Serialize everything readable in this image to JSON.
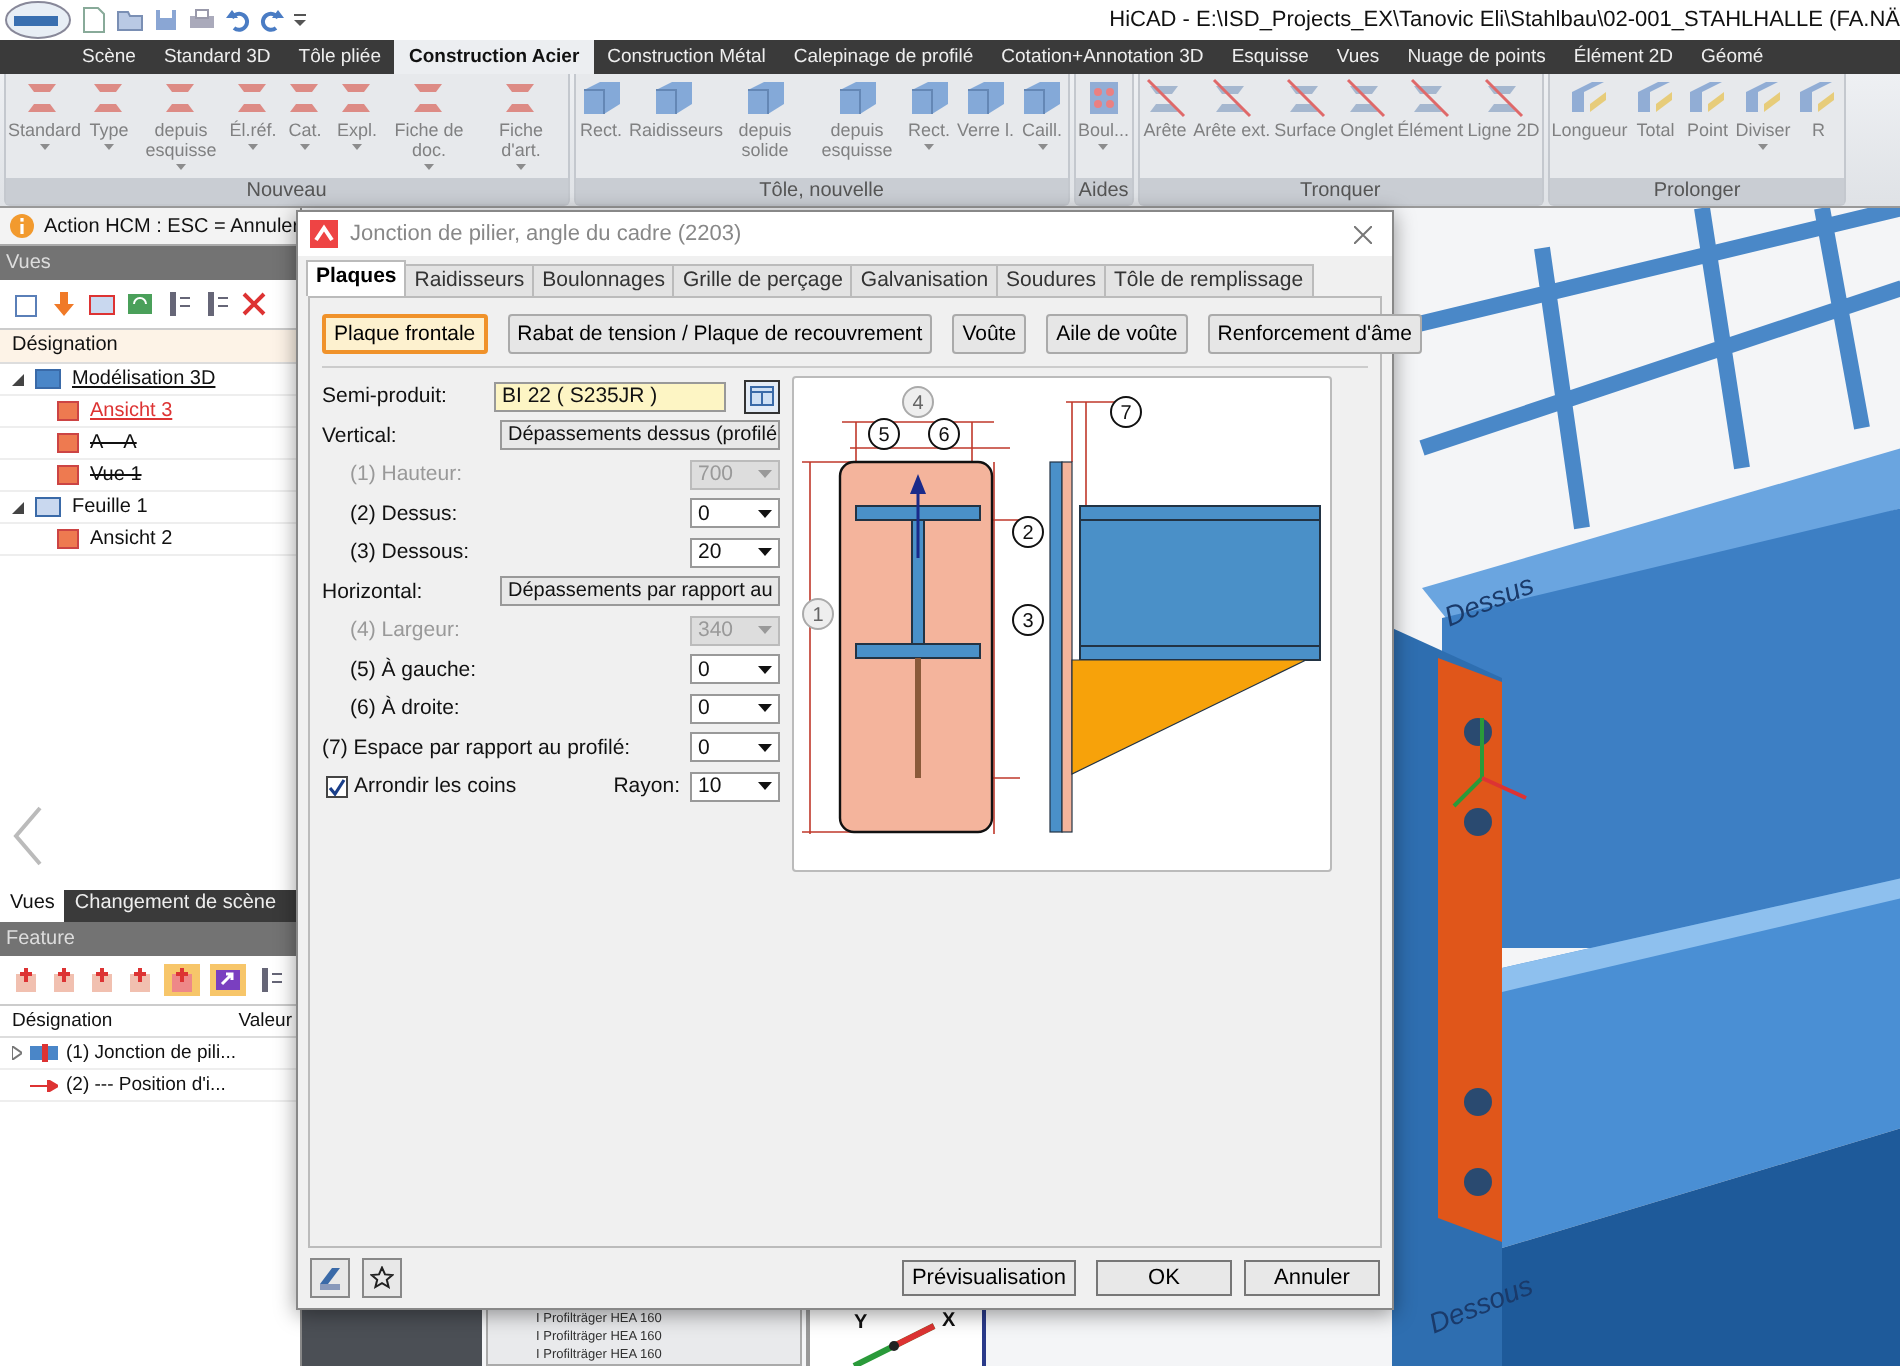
{
  "title_bar": {
    "title": "HiCAD - E:\\ISD_Projects_EX\\Tanovic Eli\\Stahlbau\\02-001_STAHLHALLE (FA.NÄ"
  },
  "ribbon_tabs": [
    {
      "label": "Scène",
      "selected": false
    },
    {
      "label": "Standard 3D",
      "selected": false
    },
    {
      "label": "Tôle pliée",
      "selected": false
    },
    {
      "label": "Construction Acier",
      "selected": true
    },
    {
      "label": "Construction Métal",
      "selected": false
    },
    {
      "label": "Calepinage de profilé",
      "selected": false
    },
    {
      "label": "Cotation+Annotation 3D",
      "selected": false
    },
    {
      "label": "Esquisse",
      "selected": false
    },
    {
      "label": "Vues",
      "selected": false
    },
    {
      "label": "Nuage de points",
      "selected": false
    },
    {
      "label": "Élément 2D",
      "selected": false
    },
    {
      "label": "Géomé",
      "selected": false
    }
  ],
  "ribbon": {
    "disabled": true,
    "groups": [
      {
        "title": "Nouveau",
        "buttons": [
          {
            "label": "Standard",
            "dropdown": true
          },
          {
            "label": "Type",
            "dropdown": true
          },
          {
            "label": "depuis esquisse",
            "dropdown": true
          },
          {
            "label": "Él.réf.",
            "dropdown": true
          },
          {
            "label": "Cat.",
            "dropdown": true
          },
          {
            "label": "Expl.",
            "dropdown": true
          },
          {
            "label": "Fiche de doc.",
            "dropdown": true
          },
          {
            "label": "Fiche d'art.",
            "dropdown": true
          }
        ]
      },
      {
        "title": "Tôle, nouvelle",
        "buttons": [
          {
            "label": "Rect.",
            "dropdown": false
          },
          {
            "label": "Raidisseurs",
            "dropdown": false
          },
          {
            "label": "depuis solide",
            "dropdown": false
          },
          {
            "label": "depuis esquisse",
            "dropdown": false
          },
          {
            "label": "Rect.",
            "dropdown": true
          },
          {
            "label": "Verre l.",
            "dropdown": false
          },
          {
            "label": "Caill.",
            "dropdown": true
          }
        ]
      },
      {
        "title": "Aides",
        "buttons": [
          {
            "label": "Boul...",
            "dropdown": true
          }
        ]
      },
      {
        "title": "Tronquer",
        "buttons": [
          {
            "label": "Arête",
            "dropdown": false
          },
          {
            "label": "Arête ext.",
            "dropdown": false
          },
          {
            "label": "Surface",
            "dropdown": false
          },
          {
            "label": "Onglet",
            "dropdown": false
          },
          {
            "label": "Élément",
            "dropdown": false
          },
          {
            "label": "Ligne 2D",
            "dropdown": false
          }
        ]
      },
      {
        "title": "Prolonger",
        "buttons": [
          {
            "label": "Longueur",
            "dropdown": false
          },
          {
            "label": "Total",
            "dropdown": false
          },
          {
            "label": "Point",
            "dropdown": false
          },
          {
            "label": "Diviser",
            "dropdown": true
          },
          {
            "label": "R",
            "dropdown": false
          }
        ]
      }
    ]
  },
  "action_hint": {
    "text": "Action HCM : ESC = Annuler"
  },
  "views_panel": {
    "title": "Vues",
    "column": "Désignation",
    "tree": [
      {
        "label": "Modélisation 3D",
        "current": true,
        "hidden": false,
        "expanded": true,
        "children": [
          {
            "label": "Ansicht 3",
            "current": true,
            "hidden": false
          },
          {
            "label": "A—A",
            "current": false,
            "hidden": true
          },
          {
            "label": "Vue 1",
            "current": false,
            "hidden": true
          }
        ]
      },
      {
        "label": "Feuille 1",
        "current": false,
        "hidden": false,
        "expanded": true,
        "children": [
          {
            "label": "Ansicht 2",
            "current": false,
            "hidden": false
          }
        ]
      }
    ]
  },
  "panel_tabs": [
    {
      "label": "Vues",
      "selected": true
    },
    {
      "label": "Changement de scène",
      "selected": false
    }
  ],
  "feature_panel": {
    "title": "Feature",
    "columns": [
      "Désignation",
      "Valeur"
    ],
    "rows": [
      {
        "label": "(1) Jonction de pili...",
        "expandable": true
      },
      {
        "label": "(2) --- Position  d'i...",
        "expandable": false
      }
    ]
  },
  "dialog": {
    "title": "Jonction de pilier, angle du cadre (2203)",
    "tabs": [
      {
        "label": "Plaques",
        "selected": true
      },
      {
        "label": "Raidisseurs",
        "selected": false
      },
      {
        "label": "Boulonnages",
        "selected": false
      },
      {
        "label": "Grille de perçage",
        "selected": false
      },
      {
        "label": "Galvanisation",
        "selected": false
      },
      {
        "label": "Soudures",
        "selected": false
      },
      {
        "label": "Tôle de remplissage",
        "selected": false
      }
    ],
    "sub_buttons": [
      {
        "label": "Plaque frontale",
        "selected": true
      },
      {
        "label": "Rabat de tension / Plaque de recouvrement",
        "selected": false
      },
      {
        "label": "Voûte",
        "selected": false
      },
      {
        "label": "Aile de voûte",
        "selected": false
      },
      {
        "label": "Renforcement d'âme",
        "selected": false
      }
    ],
    "form": [
      {
        "kind": "text",
        "label": "Semi-produit:",
        "value": "BI 22  ( S235JR )"
      },
      {
        "kind": "select",
        "label": "Vertical:",
        "value": "Dépassements dessus (profilé"
      },
      {
        "kind": "number",
        "label": "(1) Hauteur:",
        "value": "700",
        "disabled": true
      },
      {
        "kind": "number",
        "label": "(2) Dessus:",
        "value": "0",
        "disabled": false
      },
      {
        "kind": "number",
        "label": "(3) Dessous:",
        "value": "20",
        "disabled": false
      },
      {
        "kind": "select",
        "label": "Horizontal:",
        "value": "Dépassements par rapport au"
      },
      {
        "kind": "number",
        "label": "(4) Largeur:",
        "value": "340",
        "disabled": true
      },
      {
        "kind": "number",
        "label": "(5) À gauche:",
        "value": "0",
        "disabled": false
      },
      {
        "kind": "number",
        "label": "(6) À droite:",
        "value": "0",
        "disabled": false
      },
      {
        "kind": "wide_number",
        "label": "(7) Espace par rapport au profilé:",
        "value": "0",
        "disabled": false
      },
      {
        "kind": "checkbox",
        "label": "Arrondir les coins",
        "checked": true,
        "field_label": "Rayon:",
        "value": "10"
      }
    ],
    "diagram": {
      "labels": [
        {
          "text": "1",
          "disabled": true
        },
        {
          "text": "2",
          "disabled": false
        },
        {
          "text": "3",
          "disabled": false
        },
        {
          "text": "4",
          "disabled": true
        },
        {
          "text": "5",
          "disabled": false
        },
        {
          "text": "6",
          "disabled": false
        },
        {
          "text": "7",
          "disabled": false
        }
      ]
    },
    "footer_buttons": [
      {
        "label": "Prévisualisation"
      },
      {
        "label": "OK"
      },
      {
        "label": "Annuler"
      }
    ]
  },
  "viewport": {
    "labels": [
      "Dessus",
      "Dessous"
    ],
    "parts_list": [
      "I Profilträger HEA 160",
      "I Profilträger HEA 160",
      "I Profilträger HEA 160"
    ],
    "axes": [
      "Y",
      "X"
    ]
  }
}
